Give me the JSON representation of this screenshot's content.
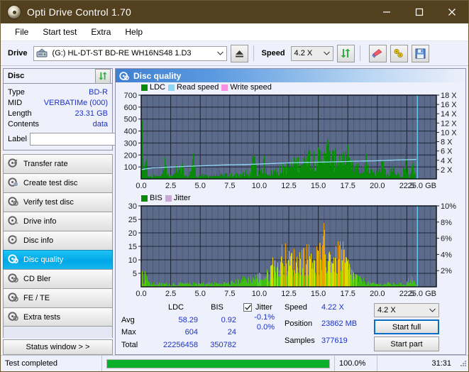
{
  "window": {
    "title": "Opti Drive Control 1.70",
    "app_icon": "disc-icon",
    "minimize_label": "─",
    "maximize_label": "□",
    "close_label": "✕",
    "titlebar_color": "#53401f"
  },
  "menu": {
    "items": [
      {
        "label": "File"
      },
      {
        "label": "Start test"
      },
      {
        "label": "Extra"
      },
      {
        "label": "Help"
      }
    ]
  },
  "toolbar": {
    "drive_label": "Drive",
    "drive_value": "(G:)   HL-DT-ST BD-RE  WH16NS48 1.D3",
    "eject_icon": "eject-icon",
    "speed_label": "Speed",
    "speed_value": "4.2 X",
    "refresh_icon": "refresh-icon",
    "erase_icon": "eraser-icon",
    "tools_icon": "wrench-icon",
    "save_icon": "floppy-save-icon"
  },
  "disc": {
    "panel_title": "Disc",
    "refresh_icon": "refresh-icon",
    "rows": [
      {
        "key": "Type",
        "value": "BD-R"
      },
      {
        "key": "MID",
        "value": "VERBATIMe (000)"
      },
      {
        "key": "Length",
        "value": "23.31 GB"
      },
      {
        "key": "Contents",
        "value": "data"
      }
    ],
    "label_key": "Label",
    "label_value": "",
    "label_placeholder": "",
    "label_button_icon": "disc-icon"
  },
  "nav": {
    "items": [
      {
        "label": "Transfer rate",
        "icon": "disc-speed-icon",
        "active": false
      },
      {
        "label": "Create test disc",
        "icon": "disc-write-icon",
        "active": false
      },
      {
        "label": "Verify test disc",
        "icon": "disc-verify-icon",
        "active": false
      },
      {
        "label": "Drive info",
        "icon": "drive-info-icon",
        "active": false
      },
      {
        "label": "Disc info",
        "icon": "disc-info-icon",
        "active": false
      },
      {
        "label": "Disc quality",
        "icon": "disc-quality-icon",
        "active": true
      },
      {
        "label": "CD Bler",
        "icon": "disc-bler-icon",
        "active": false
      },
      {
        "label": "FE / TE",
        "icon": "disc-fete-icon",
        "active": false
      },
      {
        "label": "Extra tests",
        "icon": "disc-extra-icon",
        "active": false
      }
    ],
    "status_window_label": "Status window > >"
  },
  "panel": {
    "header_title": "Disc quality",
    "header_icon": "disc-quality-icon"
  },
  "chart_data": [
    {
      "type": "area",
      "id": "ldc-chart",
      "title": "",
      "xlabel": "GB",
      "ylabel": "",
      "xlim": [
        0,
        25.0
      ],
      "ylim": [
        0,
        700
      ],
      "y2lim": [
        0,
        18
      ],
      "y2label": "X",
      "grid": true,
      "legend_position": "top-left",
      "legend": [
        {
          "name": "LDC",
          "color": "#0a8a0a"
        },
        {
          "name": "Read speed",
          "color": "#8fd8f5"
        },
        {
          "name": "Write speed",
          "color": "#f58fe0"
        }
      ],
      "xticks": [
        "0.0",
        "2.5",
        "5.0",
        "7.5",
        "10.0",
        "12.5",
        "15.0",
        "17.5",
        "20.0",
        "22.5",
        "25.0 GB"
      ],
      "yticks": [
        100,
        200,
        300,
        400,
        500,
        600,
        700
      ],
      "y2ticks": [
        "2 X",
        "4 X",
        "6 X",
        "8 X",
        "10 X",
        "12 X",
        "14 X",
        "16 X",
        "18 X"
      ],
      "series": [
        {
          "name": "LDC",
          "color": "#0a8a0a",
          "x": [
            0.0,
            0.2,
            0.4,
            0.5,
            0.6,
            0.8,
            1.0,
            1.3,
            1.6,
            2.0,
            2.3,
            2.6,
            3.0,
            3.4,
            3.7,
            4.0,
            4.4,
            4.7,
            5.0,
            5.1,
            5.4,
            5.8,
            6.2,
            6.6,
            7.0,
            7.4,
            7.8,
            8.2,
            8.6,
            9.0,
            9.3,
            9.5,
            9.8,
            10.1,
            10.4,
            10.7,
            11.0,
            11.4,
            11.8,
            12.2,
            12.6,
            13.0,
            13.4,
            13.8,
            14.0,
            14.3,
            14.6,
            15.0,
            15.3,
            15.6,
            16.0,
            16.4,
            16.6,
            16.9,
            17.2,
            17.5,
            17.8,
            18.1,
            18.4,
            18.7,
            19.0,
            19.2,
            19.5,
            19.8,
            20.1,
            20.4,
            20.7,
            21.0,
            21.2,
            21.5,
            21.8,
            22.1,
            22.4,
            22.6,
            22.8,
            23.0,
            23.2,
            23.4
          ],
          "y": [
            480,
            30,
            440,
            25,
            30,
            28,
            30,
            32,
            30,
            200,
            32,
            30,
            175,
            160,
            30,
            35,
            228,
            30,
            38,
            40,
            38,
            40,
            42,
            45,
            46,
            48,
            50,
            52,
            55,
            58,
            60,
            280,
            62,
            68,
            200,
            75,
            85,
            95,
            110,
            130,
            150,
            175,
            195,
            215,
            400,
            240,
            250,
            245,
            255,
            430,
            250,
            230,
            260,
            240,
            235,
            180,
            150,
            130,
            115,
            100,
            300,
            90,
            80,
            75,
            70,
            180,
            65,
            60,
            230,
            58,
            55,
            52,
            280,
            50,
            48,
            200,
            45,
            0
          ]
        },
        {
          "name": "Read speed",
          "color": "#8fd8f5",
          "x": [
            0.0,
            0.5,
            1.0,
            2.0,
            3.0,
            4.0,
            5.0,
            6.0,
            7.0,
            8.0,
            9.0,
            10.0,
            11.0,
            12.0,
            13.0,
            14.0,
            15.0,
            16.0,
            17.0,
            18.0,
            19.0,
            20.0,
            21.0,
            22.0,
            23.0,
            23.4
          ],
          "y_speed": [
            2.0,
            2.2,
            2.4,
            2.5,
            2.6,
            2.7,
            2.8,
            2.9,
            3.0,
            3.05,
            3.1,
            3.2,
            3.3,
            3.4,
            3.5,
            3.55,
            3.6,
            3.65,
            3.7,
            3.8,
            3.85,
            3.9,
            4.0,
            4.1,
            4.15,
            4.2
          ]
        }
      ],
      "cursor_x": 23.4
    },
    {
      "type": "area",
      "id": "bis-chart",
      "title": "",
      "xlabel": "GB",
      "ylabel": "",
      "xlim": [
        0,
        25.0
      ],
      "ylim": [
        0,
        30
      ],
      "y2lim": [
        0,
        10
      ],
      "y2label": "%",
      "grid": true,
      "legend_position": "top-left",
      "legend": [
        {
          "name": "BIS",
          "color": "#0a8a0a"
        },
        {
          "name": "Jitter",
          "color": "#cba6d8"
        }
      ],
      "xticks": [
        "0.0",
        "2.5",
        "5.0",
        "7.5",
        "10.0",
        "12.5",
        "15.0",
        "17.5",
        "20.0",
        "22.5",
        "25.0 GB"
      ],
      "yticks": [
        5,
        10,
        15,
        20,
        25,
        30
      ],
      "y2ticks": [
        "2%",
        "4%",
        "6%",
        "8%",
        "10%"
      ],
      "series": [
        {
          "name": "BIS",
          "color": "#55cc22",
          "x": [
            0.0,
            0.2,
            0.4,
            0.6,
            0.9,
            1.2,
            1.6,
            2.0,
            2.5,
            3.0,
            3.5,
            4.0,
            4.5,
            5.0,
            5.5,
            6.0,
            6.5,
            7.0,
            7.5,
            8.0,
            8.4,
            8.8,
            9.2,
            9.6,
            10.0,
            10.4,
            10.8,
            11.2,
            11.6,
            12.0,
            12.4,
            12.8,
            13.2,
            13.6,
            14.0,
            14.4,
            14.8,
            15.2,
            15.6,
            16.0,
            16.4,
            16.8,
            17.2,
            17.6,
            18.0,
            18.4,
            18.8,
            19.2,
            19.6,
            20.0,
            20.4,
            20.8,
            21.2,
            21.6,
            22.0,
            22.4,
            22.8,
            23.2,
            23.4
          ],
          "y": [
            9.2,
            2.0,
            9.0,
            1.8,
            1.6,
            1.6,
            1.5,
            1.5,
            1.5,
            1.5,
            1.6,
            1.5,
            1.6,
            1.6,
            1.6,
            1.7,
            1.7,
            1.8,
            2.0,
            2.6,
            3.4,
            4.2,
            4.0,
            4.6,
            5.2,
            5.4,
            6.4,
            13.0,
            8.0,
            18.0,
            12.0,
            14.5,
            12.0,
            16.0,
            15.0,
            17.0,
            13.5,
            16.5,
            14.0,
            16.0,
            13.0,
            18.0,
            14.0,
            9.0,
            6.0,
            4.0,
            3.2,
            2.2,
            1.6,
            1.4,
            1.3,
            1.8,
            1.4,
            1.5,
            1.4,
            1.6,
            5.0,
            1.4,
            0
          ]
        }
      ],
      "cursor_x": 23.4
    }
  ],
  "stats": {
    "columns": [
      "LDC",
      "BIS"
    ],
    "rows": [
      {
        "key": "Avg",
        "ldc": "58.29",
        "bis": "0.92"
      },
      {
        "key": "Max",
        "ldc": "604",
        "bis": "24"
      },
      {
        "key": "Total",
        "ldc": "22256458",
        "bis": "350782"
      }
    ],
    "jitter": {
      "checked": true,
      "label": "Jitter",
      "avg": "-0.1%",
      "max": "0.0%"
    },
    "speed_key": "Speed",
    "speed_value": "4.22 X",
    "position_key": "Position",
    "position_value": "23862 MB",
    "samples_key": "Samples",
    "samples_value": "377619",
    "speed_select": "4.2 X",
    "start_full_label": "Start full",
    "start_part_label": "Start part"
  },
  "statusbar": {
    "message": "Test completed",
    "progress_percent": 100.0,
    "progress_text": "100.0%",
    "elapsed": "31:31"
  }
}
